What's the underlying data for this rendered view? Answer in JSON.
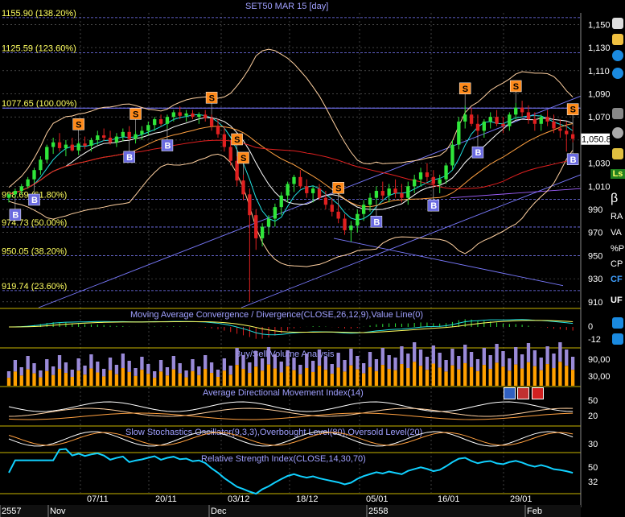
{
  "header": {
    "title": "SET50 MAR 15",
    "period": "[day]"
  },
  "colors": {
    "background": "#000000",
    "grid": "#6a6a6a",
    "separator": "#c8b400",
    "up_candle": "#2fe63a",
    "down_candle": "#e02020",
    "fib_line": "#7a7aff",
    "fib_label": "#ffff60",
    "axis_text": "#ffffff",
    "panel_title": "#a0a0ff",
    "sell_marker": "#ff8a1a",
    "buy_marker": "#6a6ae0",
    "volume_buy": "#9a8ad8",
    "volume_sell": "#ffa000",
    "rsi": "#10d0ff"
  },
  "chart_data": [
    {
      "type": "candlestick",
      "title": "SET50 MAR 15  [day]",
      "ylim": [
        905,
        1160
      ],
      "y_ticks": [
        910,
        930,
        950,
        970,
        990,
        "1,010",
        "1,030",
        "1,050",
        "1,070",
        "1,090",
        "1,110",
        "1,130",
        "1,150"
      ],
      "last_price": "1,050.8",
      "fibonacci_levels": [
        {
          "label": "1155.90 (138.20%)",
          "value": 1155.9
        },
        {
          "label": "1125.59 (123.60%)",
          "value": 1125.59
        },
        {
          "label": "1077.65 (100.00%)",
          "value": 1077.65
        },
        {
          "label": "998.69 (61.80%)",
          "value": 998.69
        },
        {
          "label": "974.73 (50.00%)",
          "value": 974.73
        },
        {
          "label": "950.05 (38.20%)",
          "value": 950.05
        },
        {
          "label": "919.74 (23.60%)",
          "value": 919.74
        }
      ],
      "x_labels": [
        "07/11",
        "20/11",
        "03/12",
        "18/12",
        "05/01",
        "16/01",
        "29/01"
      ],
      "period_labels": [
        "2557",
        "Nov",
        "Dec",
        "2558",
        "Feb"
      ],
      "signals": [
        {
          "type": "B",
          "i": 1
        },
        {
          "type": "B",
          "i": 4
        },
        {
          "type": "S",
          "i": 11
        },
        {
          "type": "S",
          "i": 20
        },
        {
          "type": "B",
          "i": 19
        },
        {
          "type": "B",
          "i": 25
        },
        {
          "type": "S",
          "i": 32
        },
        {
          "type": "S",
          "i": 36
        },
        {
          "type": "S",
          "i": 37
        },
        {
          "type": "B",
          "i": 58
        },
        {
          "type": "S",
          "i": 52
        },
        {
          "type": "B",
          "i": 67
        },
        {
          "type": "S",
          "i": 72
        },
        {
          "type": "B",
          "i": 74
        },
        {
          "type": "S",
          "i": 80
        },
        {
          "type": "B",
          "i": 89
        },
        {
          "type": "S",
          "i": 90
        }
      ],
      "candles": [
        [
          1000,
          1004,
          996,
          1003
        ],
        [
          1003,
          1008,
          1000,
          1006
        ],
        [
          1006,
          1012,
          1003,
          1010
        ],
        [
          1010,
          1018,
          1008,
          1016
        ],
        [
          1016,
          1026,
          1013,
          1024
        ],
        [
          1024,
          1036,
          1020,
          1033
        ],
        [
          1033,
          1046,
          1030,
          1044
        ],
        [
          1044,
          1052,
          1038,
          1048
        ],
        [
          1048,
          1056,
          1040,
          1043
        ],
        [
          1043,
          1050,
          1036,
          1046
        ],
        [
          1046,
          1052,
          1040,
          1041
        ],
        [
          1041,
          1049,
          1037,
          1047
        ],
        [
          1047,
          1053,
          1042,
          1045
        ],
        [
          1045,
          1052,
          1040,
          1050
        ],
        [
          1050,
          1058,
          1046,
          1054
        ],
        [
          1054,
          1060,
          1049,
          1052
        ],
        [
          1052,
          1058,
          1046,
          1048
        ],
        [
          1048,
          1056,
          1044,
          1053
        ],
        [
          1053,
          1060,
          1049,
          1057
        ],
        [
          1057,
          1062,
          1050,
          1051
        ],
        [
          1051,
          1058,
          1047,
          1055
        ],
        [
          1055,
          1062,
          1050,
          1058
        ],
        [
          1058,
          1066,
          1054,
          1063
        ],
        [
          1063,
          1070,
          1058,
          1068
        ],
        [
          1068,
          1072,
          1062,
          1064
        ],
        [
          1064,
          1072,
          1060,
          1070
        ],
        [
          1070,
          1076,
          1066,
          1074
        ],
        [
          1074,
          1079,
          1068,
          1071
        ],
        [
          1071,
          1076,
          1066,
          1073
        ],
        [
          1073,
          1076,
          1068,
          1070
        ],
        [
          1070,
          1074,
          1064,
          1072
        ],
        [
          1072,
          1076,
          1066,
          1069
        ],
        [
          1069,
          1072,
          1058,
          1062
        ],
        [
          1062,
          1068,
          1052,
          1055
        ],
        [
          1055,
          1062,
          1040,
          1044
        ],
        [
          1044,
          1050,
          1028,
          1032
        ],
        [
          1032,
          1036,
          1010,
          1015
        ],
        [
          1015,
          1020,
          998,
          1003
        ],
        [
          1003,
          1008,
          910,
          985
        ],
        [
          985,
          990,
          955,
          965
        ],
        [
          965,
          978,
          958,
          975
        ],
        [
          975,
          985,
          968,
          982
        ],
        [
          982,
          995,
          975,
          992
        ],
        [
          992,
          1005,
          985,
          1002
        ],
        [
          1002,
          1014,
          996,
          1012
        ],
        [
          1012,
          1020,
          1005,
          1018
        ],
        [
          1018,
          1024,
          1008,
          1010
        ],
        [
          1010,
          1016,
          1000,
          1004
        ],
        [
          1004,
          1010,
          996,
          1008
        ],
        [
          1008,
          1012,
          998,
          1000
        ],
        [
          1000,
          1006,
          990,
          994
        ],
        [
          994,
          1000,
          984,
          988
        ],
        [
          988,
          994,
          978,
          982
        ],
        [
          982,
          986,
          968,
          972
        ],
        [
          972,
          980,
          962,
          976
        ],
        [
          976,
          990,
          970,
          986
        ],
        [
          986,
          998,
          980,
          994
        ],
        [
          994,
          1004,
          988,
          1000
        ],
        [
          1000,
          1010,
          994,
          1006
        ],
        [
          1006,
          1014,
          998,
          1002
        ],
        [
          1002,
          1012,
          996,
          1008
        ],
        [
          1008,
          1016,
          1000,
          1004
        ],
        [
          1004,
          1012,
          996,
          1000
        ],
        [
          1000,
          1014,
          994,
          1010
        ],
        [
          1010,
          1020,
          1004,
          1016
        ],
        [
          1016,
          1026,
          1010,
          1022
        ],
        [
          1022,
          1030,
          1014,
          1018
        ],
        [
          1018,
          1024,
          1008,
          1012
        ],
        [
          1012,
          1020,
          1004,
          1016
        ],
        [
          1016,
          1030,
          1012,
          1028
        ],
        [
          1028,
          1050,
          1024,
          1046
        ],
        [
          1046,
          1070,
          1042,
          1066
        ],
        [
          1066,
          1080,
          1060,
          1072
        ],
        [
          1072,
          1078,
          1062,
          1064
        ],
        [
          1064,
          1072,
          1054,
          1058
        ],
        [
          1058,
          1068,
          1052,
          1066
        ],
        [
          1066,
          1074,
          1060,
          1070
        ],
        [
          1070,
          1076,
          1062,
          1064
        ],
        [
          1064,
          1070,
          1056,
          1062
        ],
        [
          1062,
          1074,
          1058,
          1072
        ],
        [
          1072,
          1082,
          1068,
          1078
        ],
        [
          1078,
          1084,
          1070,
          1074
        ],
        [
          1074,
          1080,
          1064,
          1068
        ],
        [
          1068,
          1074,
          1058,
          1064
        ],
        [
          1064,
          1072,
          1058,
          1070
        ],
        [
          1070,
          1076,
          1062,
          1066
        ],
        [
          1066,
          1072,
          1056,
          1060
        ],
        [
          1060,
          1068,
          1052,
          1058
        ],
        [
          1058,
          1066,
          1040,
          1055
        ],
        [
          1055,
          1062,
          1048,
          1051
        ]
      ]
    },
    {
      "type": "line",
      "title": "Moving Average Convergence / Divergence(CLOSE,26,12,9),Value Line(0)",
      "y_ticks": [
        "0",
        "-12"
      ]
    },
    {
      "type": "bar",
      "title": "Buy/Sell Volume Analysis",
      "y_ticks": [
        "90,00",
        "30,00"
      ]
    },
    {
      "type": "line",
      "title": "Average Directional Movement Index(14)",
      "y_ticks": [
        "50",
        "20"
      ]
    },
    {
      "type": "line",
      "title": "Slow Stochastics Oscillator(9,3,3),Overbought Level(80),Oversold Level(20)",
      "y_ticks": [
        "30"
      ]
    },
    {
      "type": "line",
      "title": "Relative Strength Index(CLOSE,14,30,70)",
      "y_ticks": [
        "50",
        "32"
      ]
    }
  ],
  "toolbar": {
    "items": [
      {
        "name": "beta",
        "label": "β"
      },
      {
        "name": "ra",
        "label": "RA"
      },
      {
        "name": "va",
        "label": "VA"
      },
      {
        "name": "pct-p",
        "label": "%P"
      },
      {
        "name": "cp",
        "label": "CP"
      },
      {
        "name": "cf",
        "label": "CF"
      },
      {
        "name": "uf",
        "label": "UF"
      }
    ],
    "ls_label": "Ls"
  }
}
